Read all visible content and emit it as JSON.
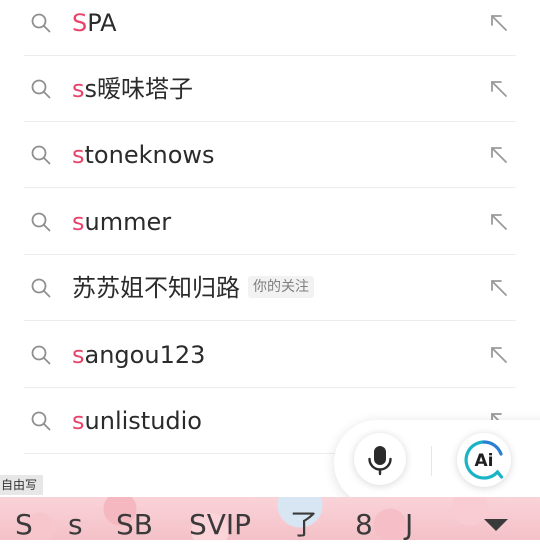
{
  "suggestions": [
    {
      "highlight": "S",
      "rest": "PA",
      "tag": ""
    },
    {
      "highlight": "s",
      "rest": "s暧味塔子",
      "tag": ""
    },
    {
      "highlight": "s",
      "rest": "toneknows",
      "tag": ""
    },
    {
      "highlight": "s",
      "rest": "ummer",
      "tag": ""
    },
    {
      "highlight": "",
      "rest": "苏苏姐不知归路",
      "tag": "你的关注"
    },
    {
      "highlight": "s",
      "rest": "angou123",
      "tag": ""
    },
    {
      "highlight": "s",
      "rest": "unlistudio",
      "tag": ""
    }
  ],
  "floating_actions": {
    "voice_icon": "microphone-icon",
    "ai_icon": "ai-assistant-icon",
    "ai_text": "Ai"
  },
  "keyboard": {
    "mode_label": "自由写",
    "candidates": [
      "S",
      "s",
      "SB",
      "SVIP",
      "了",
      "8",
      "J"
    ],
    "toggle_icon": "chevron-down-icon"
  },
  "colors": {
    "highlight": "#e8436a",
    "text": "#2b2b2b",
    "ai_accent": "#1bb3c6"
  }
}
